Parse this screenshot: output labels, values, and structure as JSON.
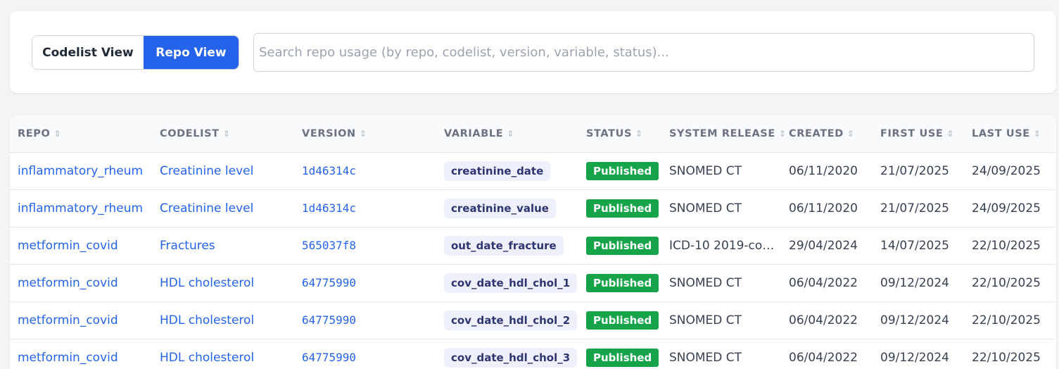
{
  "toolbar": {
    "views": [
      {
        "label": "Codelist View",
        "active": false
      },
      {
        "label": "Repo View",
        "active": true
      }
    ],
    "search": {
      "value": "",
      "placeholder": "Search repo usage (by repo, codelist, version, variable, status)..."
    }
  },
  "colors": {
    "accent": "#2563eb",
    "published": "#16a34a",
    "chip_bg": "#eef0fb"
  },
  "table": {
    "columns": [
      "REPO",
      "CODELIST",
      "VERSION",
      "VARIABLE",
      "STATUS",
      "SYSTEM RELEASE",
      "CREATED",
      "FIRST USE",
      "LAST USE"
    ],
    "sort_icon": "⇕",
    "rows": [
      [
        "inflammatory_rheum",
        "Creatinine level",
        "1d46314c",
        "creatinine_date",
        "Published",
        "SNOMED CT",
        "06/11/2020",
        "21/07/2025",
        "24/09/2025"
      ],
      [
        "inflammatory_rheum",
        "Creatinine level",
        "1d46314c",
        "creatinine_value",
        "Published",
        "SNOMED CT",
        "06/11/2020",
        "21/07/2025",
        "24/09/2025"
      ],
      [
        "metformin_covid",
        "Fractures",
        "565037f8",
        "out_date_fracture",
        "Published",
        "ICD-10 2019-co…",
        "29/04/2024",
        "14/07/2025",
        "22/10/2025"
      ],
      [
        "metformin_covid",
        "HDL cholesterol",
        "64775990",
        "cov_date_hdl_chol_1",
        "Published",
        "SNOMED CT",
        "06/04/2022",
        "09/12/2024",
        "22/10/2025"
      ],
      [
        "metformin_covid",
        "HDL cholesterol",
        "64775990",
        "cov_date_hdl_chol_2",
        "Published",
        "SNOMED CT",
        "06/04/2022",
        "09/12/2024",
        "22/10/2025"
      ],
      [
        "metformin_covid",
        "HDL cholesterol",
        "64775990",
        "cov_date_hdl_chol_3",
        "Published",
        "SNOMED CT",
        "06/04/2022",
        "09/12/2024",
        "22/10/2025"
      ]
    ]
  }
}
